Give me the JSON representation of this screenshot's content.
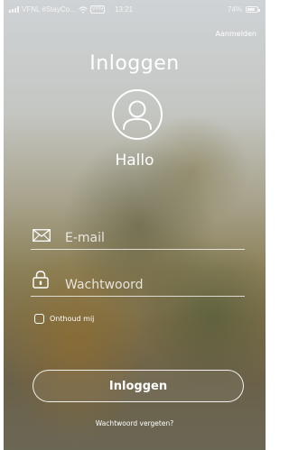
{
  "status_bar": {
    "carrier": "VFNL #StayCo...",
    "vpn": "VPN",
    "time": "13:21",
    "battery": "74%",
    "icons": [
      "signal-bars-icon",
      "wifi-icon",
      "battery-icon"
    ]
  },
  "header": {
    "register_label": "Aanmelden",
    "title": "Inloggen"
  },
  "profile": {
    "avatar_icon": "user-circle-icon",
    "greeting": "Hallo"
  },
  "form": {
    "email": {
      "placeholder": "E-mail",
      "value": "",
      "icon": "envelope-icon"
    },
    "password": {
      "placeholder": "Wachtwoord",
      "value": "",
      "icon": "padlock-icon"
    },
    "remember": {
      "label": "Onthoud mij",
      "checked": false
    },
    "submit_label": "Inloggen",
    "forgot_label": "Wachtwoord vergeten?"
  },
  "colors": {
    "text": "#ffffff",
    "background_top": "#cfd3d6",
    "background_bottom": "#6b6755"
  }
}
